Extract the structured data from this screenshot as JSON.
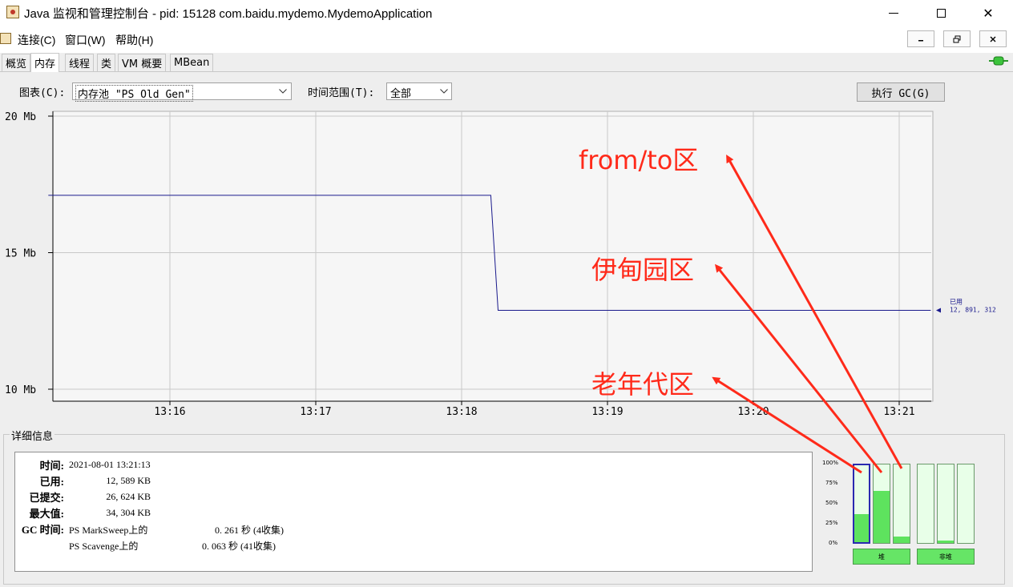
{
  "window": {
    "title": "Java 监视和管理控制台 - pid: 15128 com.baidu.mydemo.MydemoApplication",
    "close_glyph": "✕"
  },
  "menu": {
    "connect": "连接(C)",
    "window": "窗口(W)",
    "help": "帮助(H)"
  },
  "tabs": [
    "概览",
    "内存",
    "线程",
    "类",
    "VM 概要",
    "MBean"
  ],
  "controls": {
    "chart_label": "图表(C):",
    "chart_value": "内存池 \"PS Old Gen\"",
    "range_label": "时间范围(T):",
    "range_value": "全部",
    "gc_button": "执行 GC(G)"
  },
  "chart_data": {
    "type": "line",
    "y_ticks": [
      "20 Mb",
      "15 Mb",
      "10 Mb"
    ],
    "x_ticks": [
      "13:16",
      "13:17",
      "13:18",
      "13:19",
      "13:20",
      "13:21"
    ],
    "ylim": [
      10,
      20
    ],
    "series": [
      {
        "name": "已用",
        "points": [
          [
            "13:15:10",
            17.1
          ],
          [
            "13:18:12",
            17.1
          ],
          [
            "13:18:15",
            12.89
          ],
          [
            "13:21:13",
            12.89
          ]
        ]
      }
    ],
    "current_label": "已用",
    "current_value": "12, 891, 312",
    "grid": true,
    "line_color": "#1a1a8c"
  },
  "details": {
    "title": "详细信息",
    "rows": [
      {
        "key": "时间:",
        "value": "2021-08-01 13:21:13"
      },
      {
        "key": "已用:",
        "value": "12, 589 KB"
      },
      {
        "key": "已提交:",
        "value": "26, 624 KB"
      },
      {
        "key": "最大值:",
        "value": "34, 304 KB"
      }
    ],
    "gc_key": "GC 时间:",
    "gc_rows": [
      {
        "name": "PS MarkSweep上的",
        "time": "0. 261 秒 (4收集)"
      },
      {
        "name": "PS Scavenge上的",
        "time": "0. 063 秒 (41收集)"
      }
    ]
  },
  "pools": {
    "pct_labels": [
      "100%",
      "75%",
      "50%",
      "25%",
      "0%"
    ],
    "heap": [
      0.36,
      0.66,
      0.08
    ],
    "nonheap": [
      0.0,
      0.03,
      0.0
    ],
    "heap_label": "堆",
    "nonheap_label": "非堆"
  },
  "annotations": {
    "from_to": "from/to区",
    "eden": "伊甸园区",
    "old": "老年代区"
  },
  "colors": {
    "annotation": "#ff2a1a",
    "bar_fill": "#5ee35e",
    "bar_empty": "#e8ffe8",
    "series": "#1a1a8c"
  }
}
